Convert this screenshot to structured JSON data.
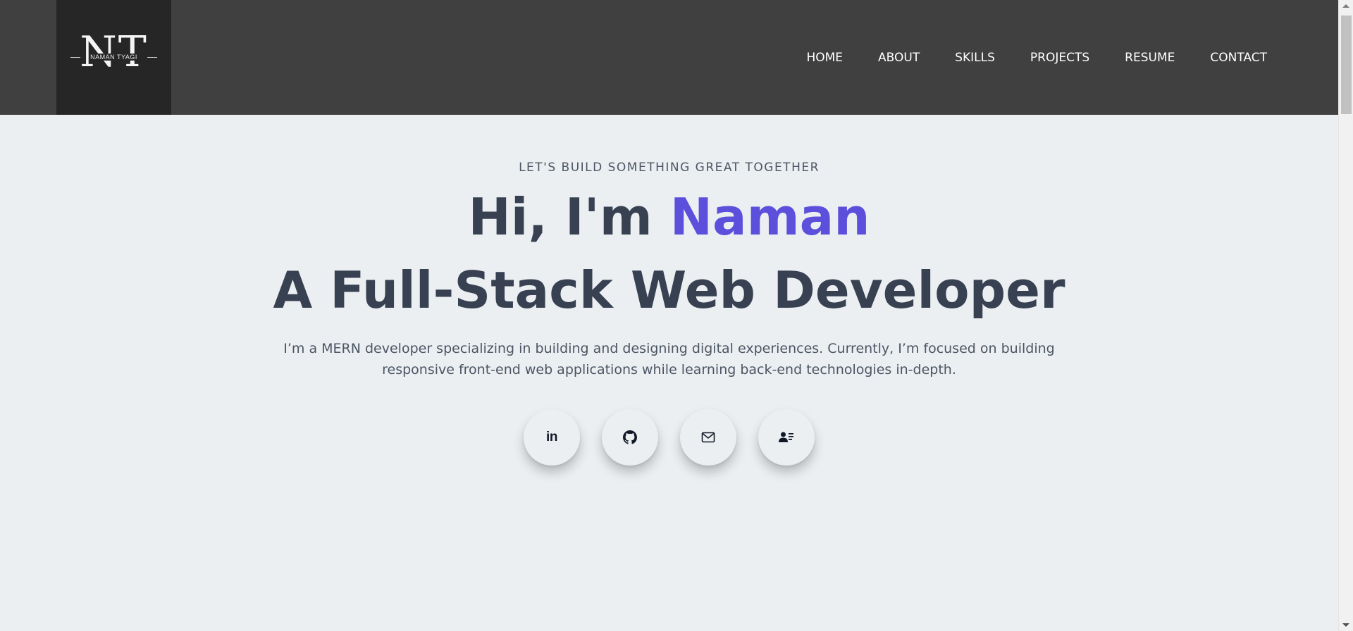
{
  "logo": {
    "letters": "NT",
    "name": "NAMAN TYAGI"
  },
  "nav": {
    "items": [
      {
        "label": "HOME"
      },
      {
        "label": "ABOUT"
      },
      {
        "label": "SKILLS"
      },
      {
        "label": "PROJECTS"
      },
      {
        "label": "RESUME"
      },
      {
        "label": "CONTACT"
      }
    ]
  },
  "hero": {
    "tagline": "LET'S BUILD SOMETHING GREAT TOGETHER",
    "greeting": "Hi, I'm ",
    "name": "Naman",
    "role": "A Full-Stack Web Developer",
    "intro": "I’m a MERN developer specializing in building and designing digital experiences. Currently, I’m focused on building responsive front-end web applications while learning back-end technologies in-depth.",
    "linkedin_glyph": "in"
  },
  "socials": [
    {
      "icon": "linkedin-icon"
    },
    {
      "icon": "github-icon"
    },
    {
      "icon": "mail-icon"
    },
    {
      "icon": "contact-card-icon"
    }
  ],
  "colors": {
    "header_bg": "#404040",
    "logo_bg": "#262626",
    "page_bg": "#eceff2",
    "accent": "#5b4fdc",
    "heading": "#374151"
  }
}
